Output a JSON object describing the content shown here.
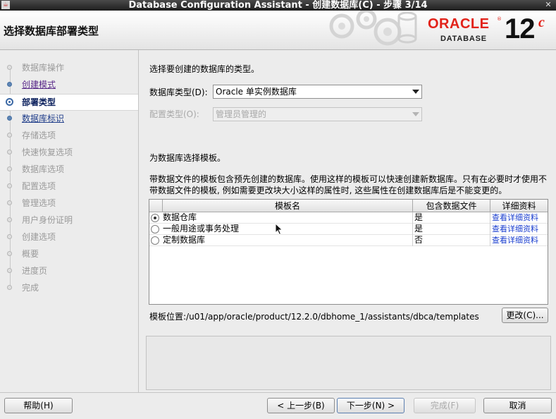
{
  "window": {
    "title": "Database Configuration Assistant - 创建数据库(C) - 步骤 3/14",
    "icon": "java-icon",
    "close_icon": "close-icon"
  },
  "header": {
    "step_title": "选择数据库部署类型",
    "brand": {
      "name": "ORACLE",
      "registered": "®",
      "product": "DATABASE",
      "version": "12",
      "version_suffix": "c",
      "color": "#e2231a"
    }
  },
  "nav": {
    "items": [
      {
        "label": "数据库操作",
        "state": "disabled"
      },
      {
        "label": "创建模式",
        "state": "done"
      },
      {
        "label": "部署类型",
        "state": "current"
      },
      {
        "label": "数据库标识",
        "state": "next"
      },
      {
        "label": "存储选项",
        "state": "disabled"
      },
      {
        "label": "快速恢复选项",
        "state": "disabled"
      },
      {
        "label": "数据库选项",
        "state": "disabled"
      },
      {
        "label": "配置选项",
        "state": "disabled"
      },
      {
        "label": "管理选项",
        "state": "disabled"
      },
      {
        "label": "用户身份证明",
        "state": "disabled"
      },
      {
        "label": "创建选项",
        "state": "disabled"
      },
      {
        "label": "概要",
        "state": "disabled"
      },
      {
        "label": "进度页",
        "state": "disabled"
      },
      {
        "label": "完成",
        "state": "disabled"
      }
    ]
  },
  "main": {
    "db_type_prompt": "选择要创建的数据库的类型。",
    "db_type_label": "数据库类型(D):",
    "db_type_value": "Oracle 单实例数据库",
    "config_type_label": "配置类型(O):",
    "config_type_value": "管理员管理的",
    "template_prompt": "为数据库选择模板。",
    "template_desc_1": "带数据文件的模板包含预先创建的数据库。使用这样的模板可以快速创建新数据库。只有在必要时才使用不",
    "template_desc_2": "带数据文件的模板, 例如需要更改块大小这样的属性时, 这些属性在创建数据库后是不能变更的。",
    "table": {
      "headers": [
        "模板名",
        "包含数据文件",
        "详细资料"
      ],
      "rows": [
        {
          "name": "数据仓库",
          "has_datafiles": "是",
          "details": "查看详细资料",
          "selected": true
        },
        {
          "name": "一般用途或事务处理",
          "has_datafiles": "是",
          "details": "查看详细资料",
          "selected": false
        },
        {
          "name": "定制数据库",
          "has_datafiles": "否",
          "details": "查看详细资料",
          "selected": false
        }
      ]
    },
    "template_location_label": "模板位置:",
    "template_location_value": "/u01/app/oracle/product/12.2.0/dbhome_1/assistants/dbca/templates",
    "change_button": "更改(C)..."
  },
  "footer": {
    "help": "帮助(H)",
    "back": "< 上一步(B)",
    "next": "下一步(N) >",
    "finish": "完成(F)",
    "cancel": "取消"
  }
}
